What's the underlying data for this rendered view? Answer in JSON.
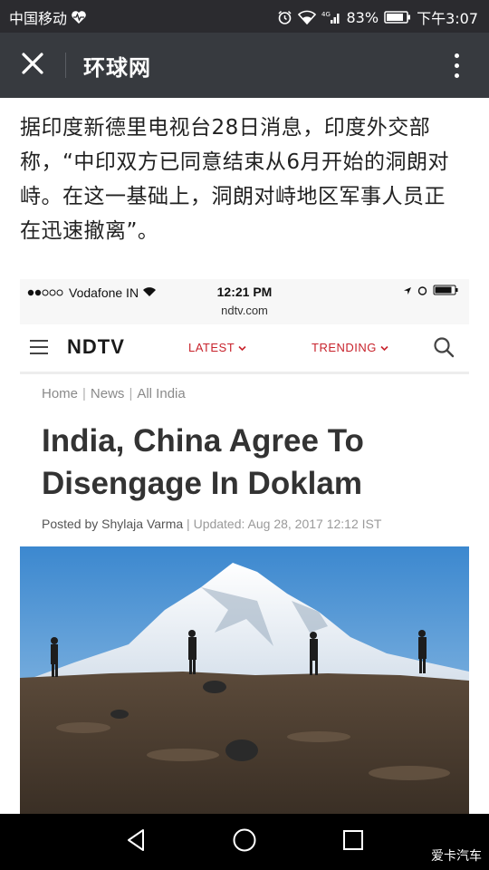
{
  "status_bar": {
    "carrier": "中国移动",
    "battery": "83%",
    "time": "下午3:07"
  },
  "title_bar": {
    "title": "环球网"
  },
  "article": {
    "lines": [
      "据印度新德里电视台28日消息，印度外交部",
      "称，“中印双方已同意结束从6月开始的洞朗对",
      "峙。在这一基础上，洞朗对峙地区军事人员正",
      "在迅速撤离”。"
    ]
  },
  "embedded_screenshot": {
    "status": {
      "carrier": "Vodafone IN",
      "time": "12:21 PM",
      "url": "ndtv.com"
    },
    "nav": {
      "logo": "NDTV",
      "latest": "LATEST",
      "trending": "TRENDING"
    },
    "breadcrumb": [
      "Home",
      "News",
      "All India"
    ],
    "headline_lines": [
      "India, China Agree To",
      "Disengage In Doklam"
    ],
    "byline": {
      "author": "Posted by Shylaja Varma",
      "updated": "Updated: Aug 28, 2017 12:12 IST"
    }
  },
  "watermark": "爱卡汽车",
  "colors": {
    "status_bar_bg": "#2b2b2f",
    "title_bar_bg": "#373a3f",
    "ndtv_accent": "#c8232c",
    "nav_bar_bg": "#000000"
  },
  "icons": [
    "heart-monitor-icon",
    "alarm-icon",
    "wifi-icon",
    "signal-4g-icon",
    "battery-icon",
    "close-icon",
    "more-vertical-icon",
    "hamburger-icon",
    "search-icon",
    "back-icon",
    "home-icon",
    "recents-icon"
  ]
}
